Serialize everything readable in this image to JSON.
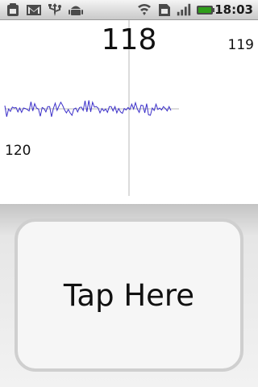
{
  "status_bar": {
    "time": "18:03",
    "icons": [
      "notification-icon",
      "gmail-icon",
      "usb-icon",
      "android-debug-icon",
      "wifi-icon",
      "sim-icon",
      "signal-icon",
      "battery-icon"
    ],
    "battery_color": "#2f9e1a"
  },
  "graph": {
    "current_value": "118",
    "max_value": "119",
    "min_value": "120",
    "line_color": "#3b2fc9",
    "axis_color": "#b8b8b8",
    "series": [
      22.8,
      20.5,
      22.1,
      21.6,
      22.5,
      22.3,
      22.4,
      21.5,
      22.3,
      21.4,
      22.3,
      22.2,
      22.0,
      21.7,
      23.6,
      21.7,
      23.2,
      22.3,
      22.1,
      20.6,
      22.4,
      22.2,
      21.5,
      22.6,
      22.6,
      20.5,
      22.2,
      23.3,
      21.8,
      22.7,
      23.5,
      22.8,
      21.9,
      21.3,
      22.0,
      21.3,
      20.8,
      22.1,
      22.3,
      21.5,
      22.4,
      22.5,
      21.8,
      23.8,
      21.5,
      23.9,
      21.5,
      23.5,
      22.5,
      22.6,
      22.3,
      21.3,
      22.2,
      21.7,
      22.1,
      21.4,
      22.6,
      22.6,
      21.7,
      22.6,
      21.3,
      22.2,
      21.5,
      21.2,
      22.2,
      21.9,
      22.4,
      22.0,
      23.1,
      22.1,
      23.4,
      22.1,
      21.4,
      22.9,
      22.8,
      21.3,
      23.2,
      20.9,
      20.8,
      22.3,
      21.8,
      23.1,
      22.0,
      22.3,
      21.9,
      22.6,
      22.2,
      21.7,
      22.6,
      21.8
    ]
  },
  "tap_button": {
    "label": "Tap Here"
  }
}
